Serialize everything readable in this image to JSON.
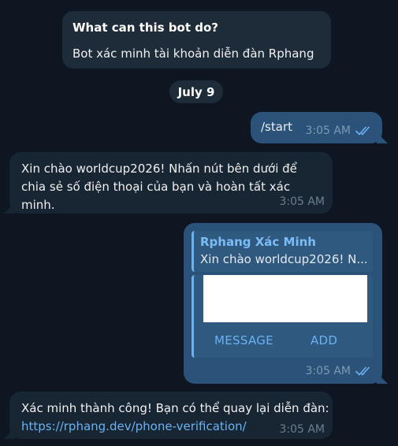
{
  "intro": {
    "title": "What can this bot do?",
    "body": "Bot xác minh tài khoản diễn đàn Rphang"
  },
  "date_separator": "July 9",
  "messages": {
    "start": {
      "text": "/start",
      "time": "3:05 AM"
    },
    "welcome": {
      "text": "Xin chào worldcup2026! Nhấn nút bên dưới để chia sẻ số điện thoại của bạn và hoàn tất xác minh.",
      "time": "3:05 AM"
    },
    "share": {
      "reply_name": "Rphang Xác Minh",
      "reply_snippet": "Xin chào worldcup2026! N...",
      "button_message": "MESSAGE",
      "button_add": "ADD",
      "time": "3:05 AM"
    },
    "done": {
      "text": "Xác minh thành công! Bạn có thể quay lại diễn đàn:",
      "link": "https://rphang.dev/phone-verification/",
      "time": "3:05 AM"
    }
  },
  "colors": {
    "background": "#0e1621",
    "outgoing_bubble": "#2b5278",
    "incoming_bubble": "#182533",
    "accent": "#6ab2f2"
  },
  "icons": {
    "read_receipt": "double-check-icon"
  }
}
